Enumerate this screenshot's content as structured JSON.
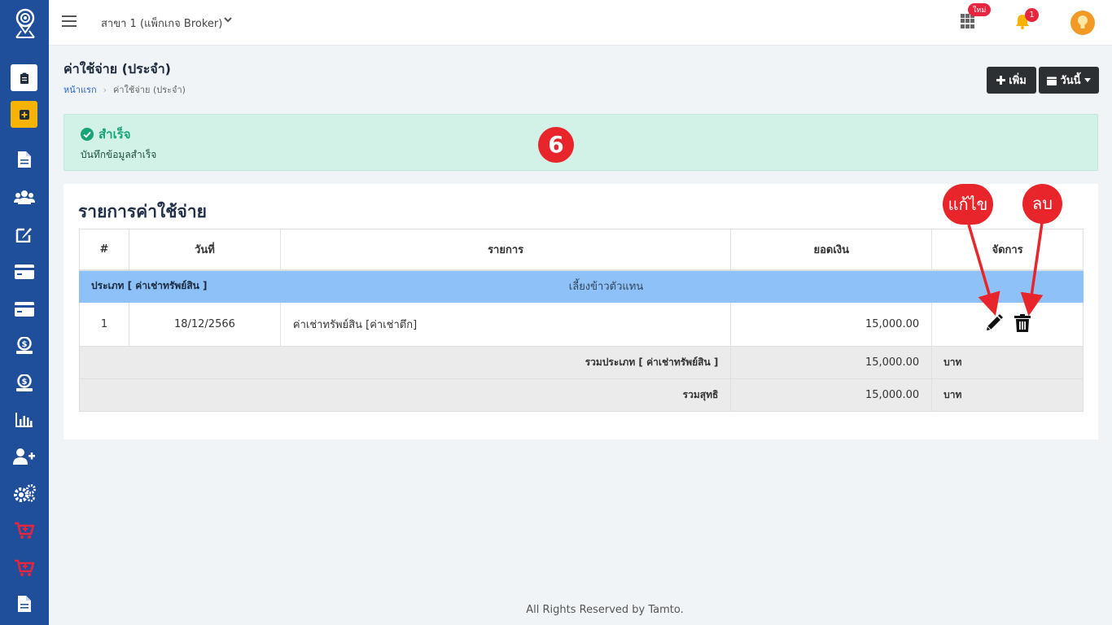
{
  "topbar": {
    "branch": "สาขา 1 (แพ็กเกจ Broker)",
    "new_badge": "ใหม่",
    "notification_count": "1"
  },
  "header": {
    "title": "ค่าใช้จ่าย (ประจำ)",
    "breadcrumb_home": "หน้าแรก",
    "breadcrumb_current": "ค่าใช้จ่าย (ประจำ)",
    "add_label": "เพิ่ม",
    "today_label": "วันนี้"
  },
  "alert": {
    "title": "สำเร็จ",
    "message": "บันทึกข้อมูลสำเร็จ",
    "step_number": "6"
  },
  "card": {
    "title": "รายการค่าใช้จ่าย"
  },
  "table": {
    "headers": [
      "#",
      "วันที่",
      "รายการ",
      "ยอดเงิน",
      "จัดการ"
    ],
    "category_label": "ประเภท [ ค่าเช่าทรัพย์สิน ]",
    "category_note": "เลี้ยงข้าวตัวแทน",
    "row": {
      "no": "1",
      "date": "18/12/2566",
      "item": "ค่าเช่าทรัพย์สิน  [ค่าเช่าตึก]",
      "amount": "15,000.00"
    },
    "subtotal_label": "รวมประเภท [ ค่าเช่าทรัพย์สิน ]",
    "subtotal_amount": "15,000.00",
    "subtotal_unit": "บาท",
    "total_label": "รวมสุทธิ",
    "total_amount": "15,000.00",
    "total_unit": "บาท"
  },
  "callouts": {
    "edit": "แก้ไข",
    "delete": "ลบ"
  },
  "footer": "All Rights Reserved by Tamto.",
  "colors": {
    "sidebar": "#1f4e9a",
    "accent_yellow": "#f6b400",
    "success_bg": "#d2f2e8",
    "category_row": "#8ec1f7",
    "callout_red": "#e8252b",
    "cart_icon": "#e8253f"
  }
}
